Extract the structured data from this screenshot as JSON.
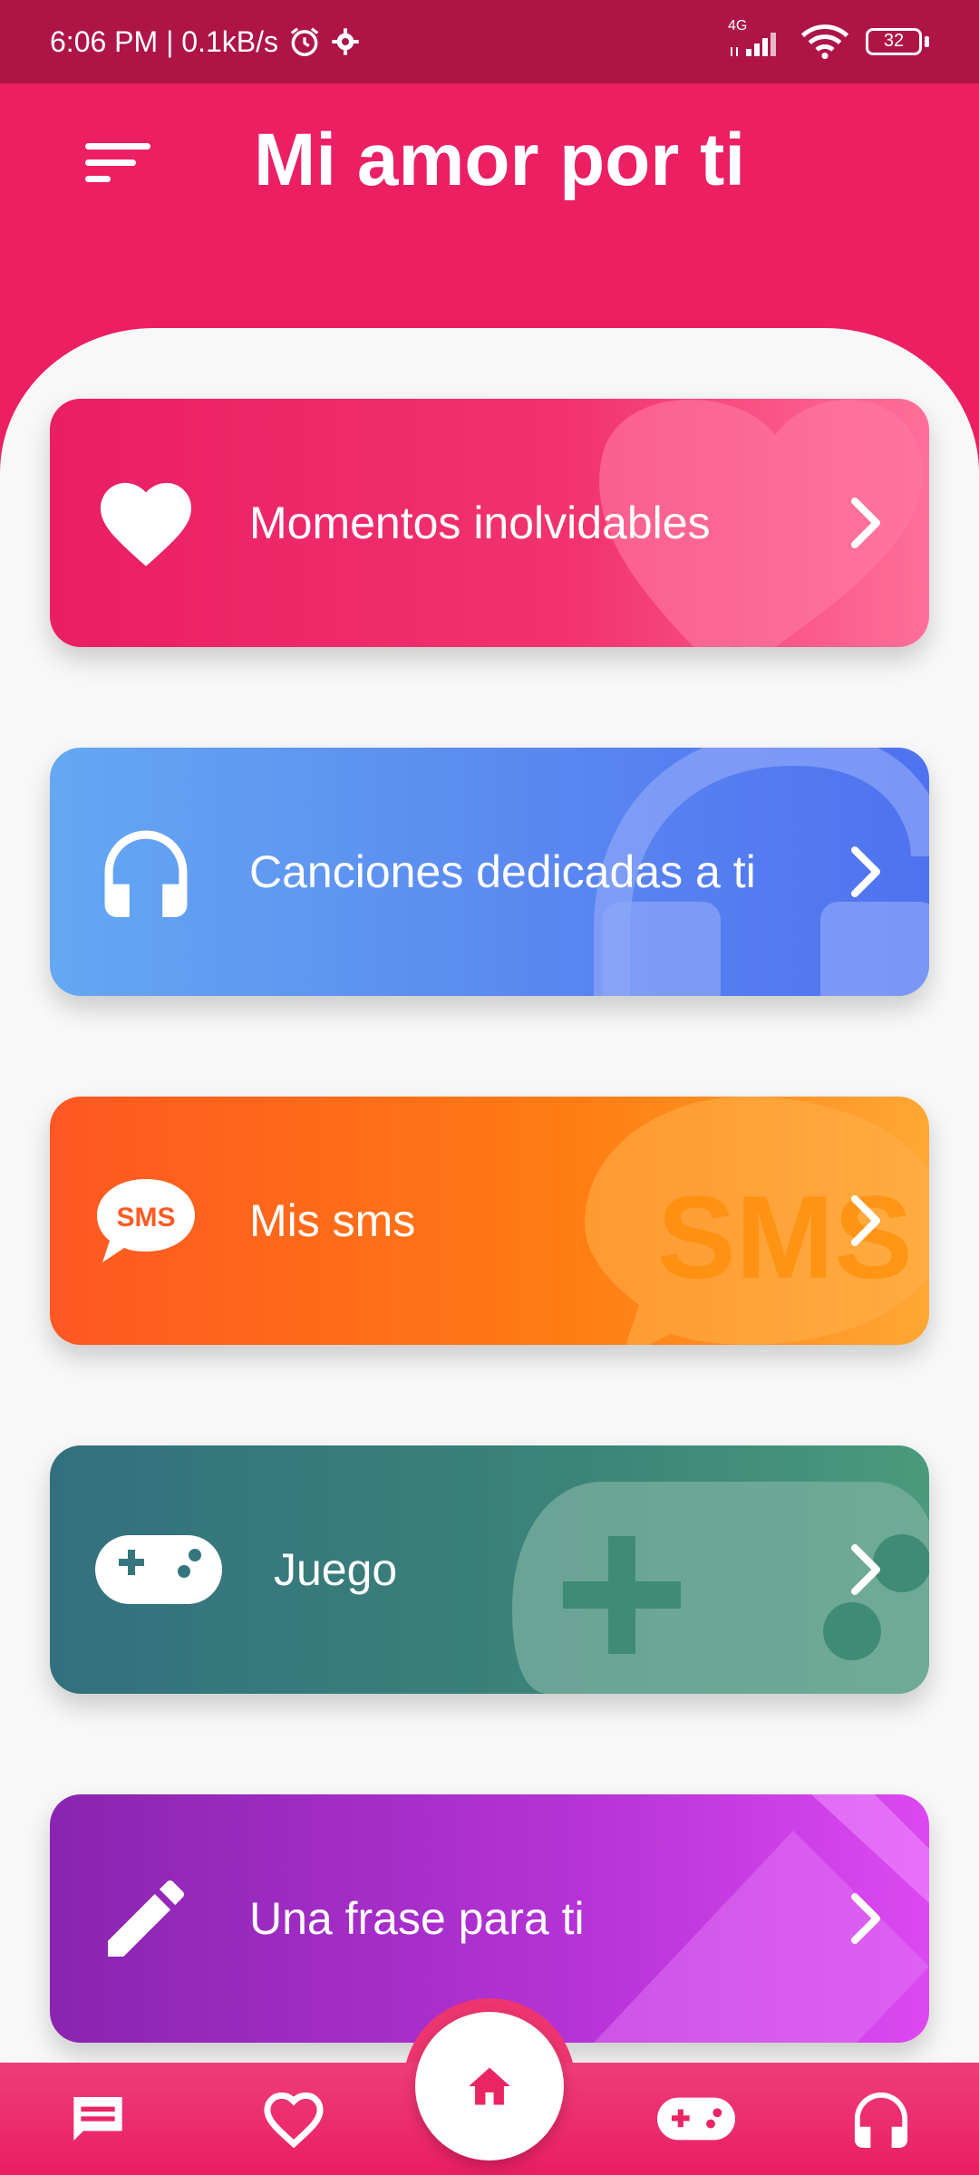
{
  "status_bar": {
    "time": "6:06 PM | 0.1kB/s",
    "network": "4G",
    "battery": "32"
  },
  "header": {
    "title": "Mi amor por ti"
  },
  "cards": [
    {
      "label": "Momentos inolvidables",
      "icon": "heart-icon",
      "gradient": [
        "#e91e63",
        "#ff6f9a"
      ]
    },
    {
      "label": "Canciones dedicadas a ti",
      "icon": "headphones-icon",
      "gradient": [
        "#64a8f2",
        "#4f72f0"
      ]
    },
    {
      "label": "Mis sms",
      "icon": "sms-bubble-icon",
      "icon_text": "SMS",
      "gradient": [
        "#ff5722",
        "#ffa734"
      ]
    },
    {
      "label": "Juego",
      "icon": "gamepad-icon",
      "gradient": [
        "#33707f",
        "#4a9a7c"
      ]
    },
    {
      "label": "Una frase para ti",
      "icon": "pencil-icon",
      "gradient": [
        "#8a24b0",
        "#dc48f1"
      ]
    }
  ],
  "bottom_nav": {
    "items": [
      "chat-icon",
      "heart-outline-icon",
      "home-icon",
      "gamepad-icon",
      "headphones-icon"
    ],
    "active": "home-icon"
  },
  "colors": {
    "primary": "#eb1f62",
    "status_bar": "#ae1546",
    "background": "#f8f8f8"
  }
}
